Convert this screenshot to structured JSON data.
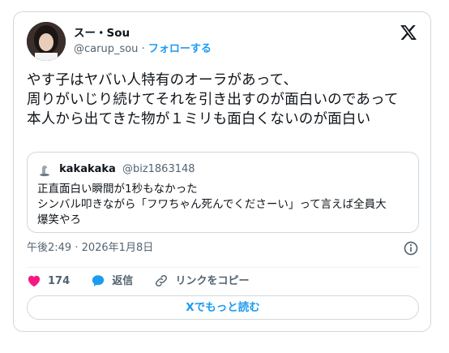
{
  "tweet": {
    "author": {
      "display_name": "スー・Sou",
      "handle": "@carup_sou",
      "separator": "·",
      "follow_label": "フォローする"
    },
    "text_lines": [
      "やす子はヤバい人特有のオーラがあって、",
      "周りがいじり続けてそれを引き出すのが面白いのであっ",
      "て",
      "本人から出てきた物が１ミリも面白くないのが面白い"
    ],
    "timestamp": "午後2:49 · 2026年1月8日",
    "likes_count": "174",
    "reply_label": "返信",
    "copy_link_label": "リンクをコピー",
    "read_more_label": "Xでもっと読む"
  },
  "quoted": {
    "display_name": "kakakaka",
    "handle": "@biz1863148",
    "text_lines": [
      "正直面白い瞬間が1秒もなかった",
      "シンバル叩きながら「フワちゃん死んでくださーい」って言えば全員大",
      "爆笑やろ"
    ]
  },
  "icons": {
    "platform": "x-logo-icon",
    "info": "info-icon",
    "like": "heart-icon",
    "reply": "speech-bubble-icon",
    "link": "link-icon"
  },
  "colors": {
    "accent": "#1d9bf0",
    "like": "#f91880",
    "text": "#0f1419",
    "muted": "#536471",
    "border": "#cfd9de"
  }
}
